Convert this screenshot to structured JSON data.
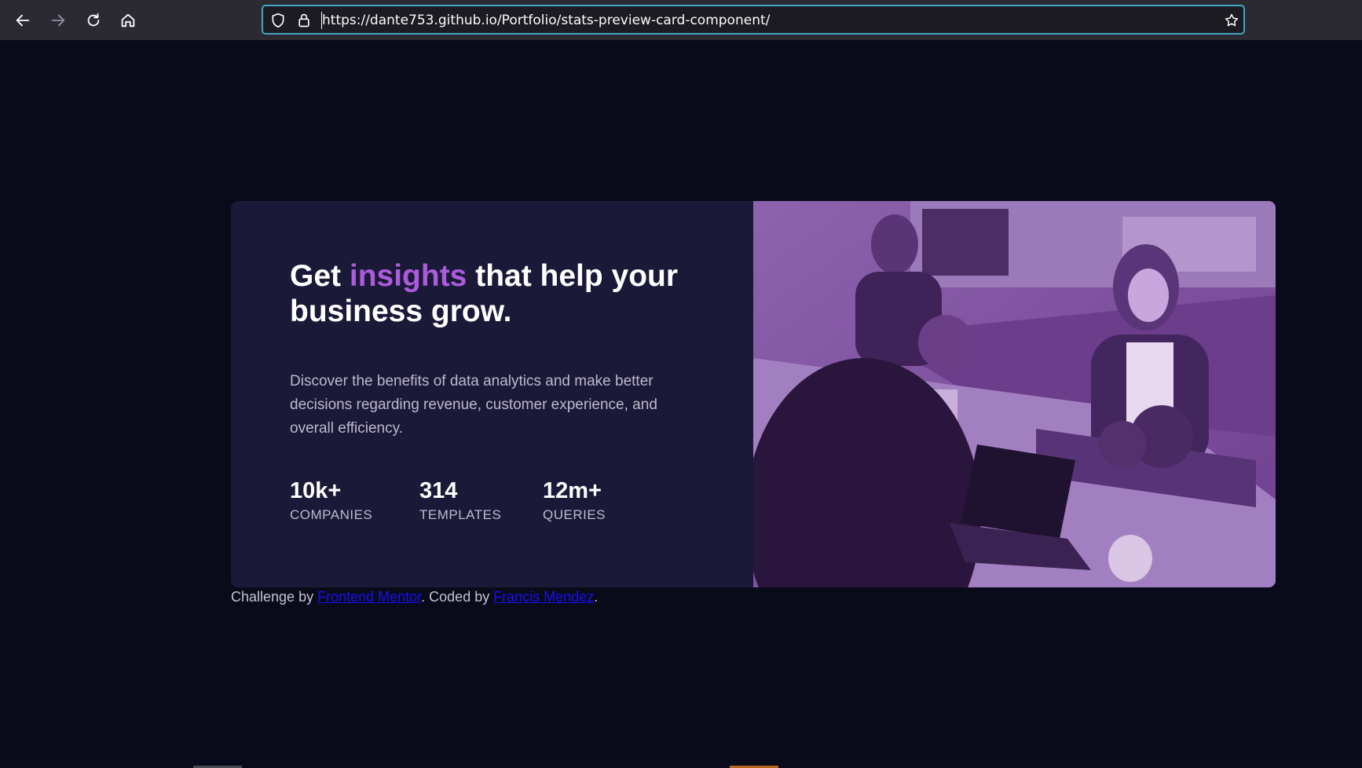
{
  "browser": {
    "url": "https://dante753.github.io/Portfolio/stats-preview-card-component/",
    "icons": [
      "back-icon",
      "forward-icon",
      "reload-icon",
      "home-icon",
      "shield-icon",
      "lock-icon",
      "star-icon"
    ]
  },
  "card": {
    "headline_before": "Get ",
    "headline_accent": "insights",
    "headline_after": " that help your business grow.",
    "description": "Discover the benefits of data analytics and make better decisions regarding revenue, customer experience, and overall efficiency.",
    "stats": [
      {
        "value": "10k+",
        "label": "COMPANIES"
      },
      {
        "value": "314",
        "label": "TEMPLATES"
      },
      {
        "value": "12m+",
        "label": "QUERIES"
      }
    ],
    "colors": {
      "accent": "#aa5cdb",
      "card_background": "#1b1938",
      "image_tint": "#7a4b9a"
    }
  },
  "footer": {
    "prefix": "Challenge by ",
    "link1": "Frontend Mentor",
    "middle": ". Coded by ",
    "link2": "Francis Mendez",
    "suffix": "."
  }
}
